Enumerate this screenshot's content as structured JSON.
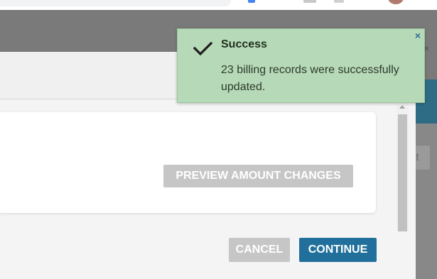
{
  "toast": {
    "title": "Success",
    "message": "23 billing records were successfully updated.",
    "close_symbol": "×",
    "icon": "checkmark-icon",
    "background_color": "#b6d9b7",
    "close_color": "#2b6e98"
  },
  "modal": {
    "preview_button_label": "PREVIEW AMOUNT CHANGES",
    "cancel_button_label": "CANCEL",
    "continue_button_label": "CONTINUE",
    "continue_color": "#21709c",
    "disabled_color": "#c6c6c6"
  },
  "background": {
    "partial_button_label": "nt",
    "header_color": "#2e6b85"
  }
}
